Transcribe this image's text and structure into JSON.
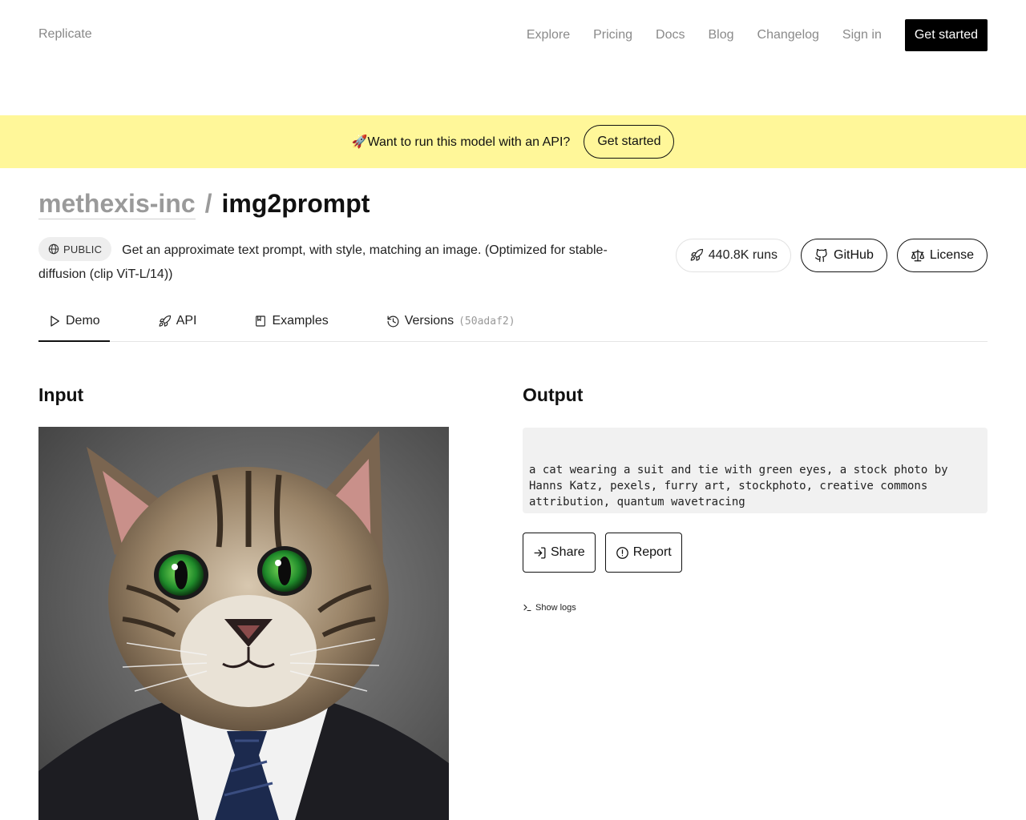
{
  "nav": {
    "brand": "Replicate",
    "links": [
      "Explore",
      "Pricing",
      "Docs",
      "Blog",
      "Changelog",
      "Sign in"
    ],
    "cta": "Get started"
  },
  "banner": {
    "text": "🚀Want to run this model with an API?",
    "cta": "Get started",
    "bg_color": "#fff799"
  },
  "model": {
    "owner": "methexis-inc",
    "separator": "/",
    "name": "img2prompt",
    "visibility": "PUBLIC",
    "description": "Get an approximate text prompt, with style, matching an image. (Optimized for stable-diffusion (clip ViT-L/14))",
    "runs": "440.8K runs",
    "github_label": "GitHub",
    "license_label": "License"
  },
  "tabs": [
    {
      "label": "Demo",
      "icon": "play-icon",
      "active": true
    },
    {
      "label": "API",
      "icon": "rocket-icon",
      "active": false
    },
    {
      "label": "Examples",
      "icon": "bookmark-icon",
      "active": false
    },
    {
      "label": "Versions",
      "icon": "history-icon",
      "active": false,
      "hash": "(50adaf2)"
    }
  ],
  "input": {
    "title": "Input"
  },
  "output": {
    "title": "Output",
    "text": "a cat wearing a suit and tie with green eyes, a stock photo by Hanns Katz, pexels, furry art, stockphoto, creative commons attribution, quantum wavetracing",
    "share_label": "Share",
    "report_label": "Report",
    "logs_label": "Show logs"
  }
}
